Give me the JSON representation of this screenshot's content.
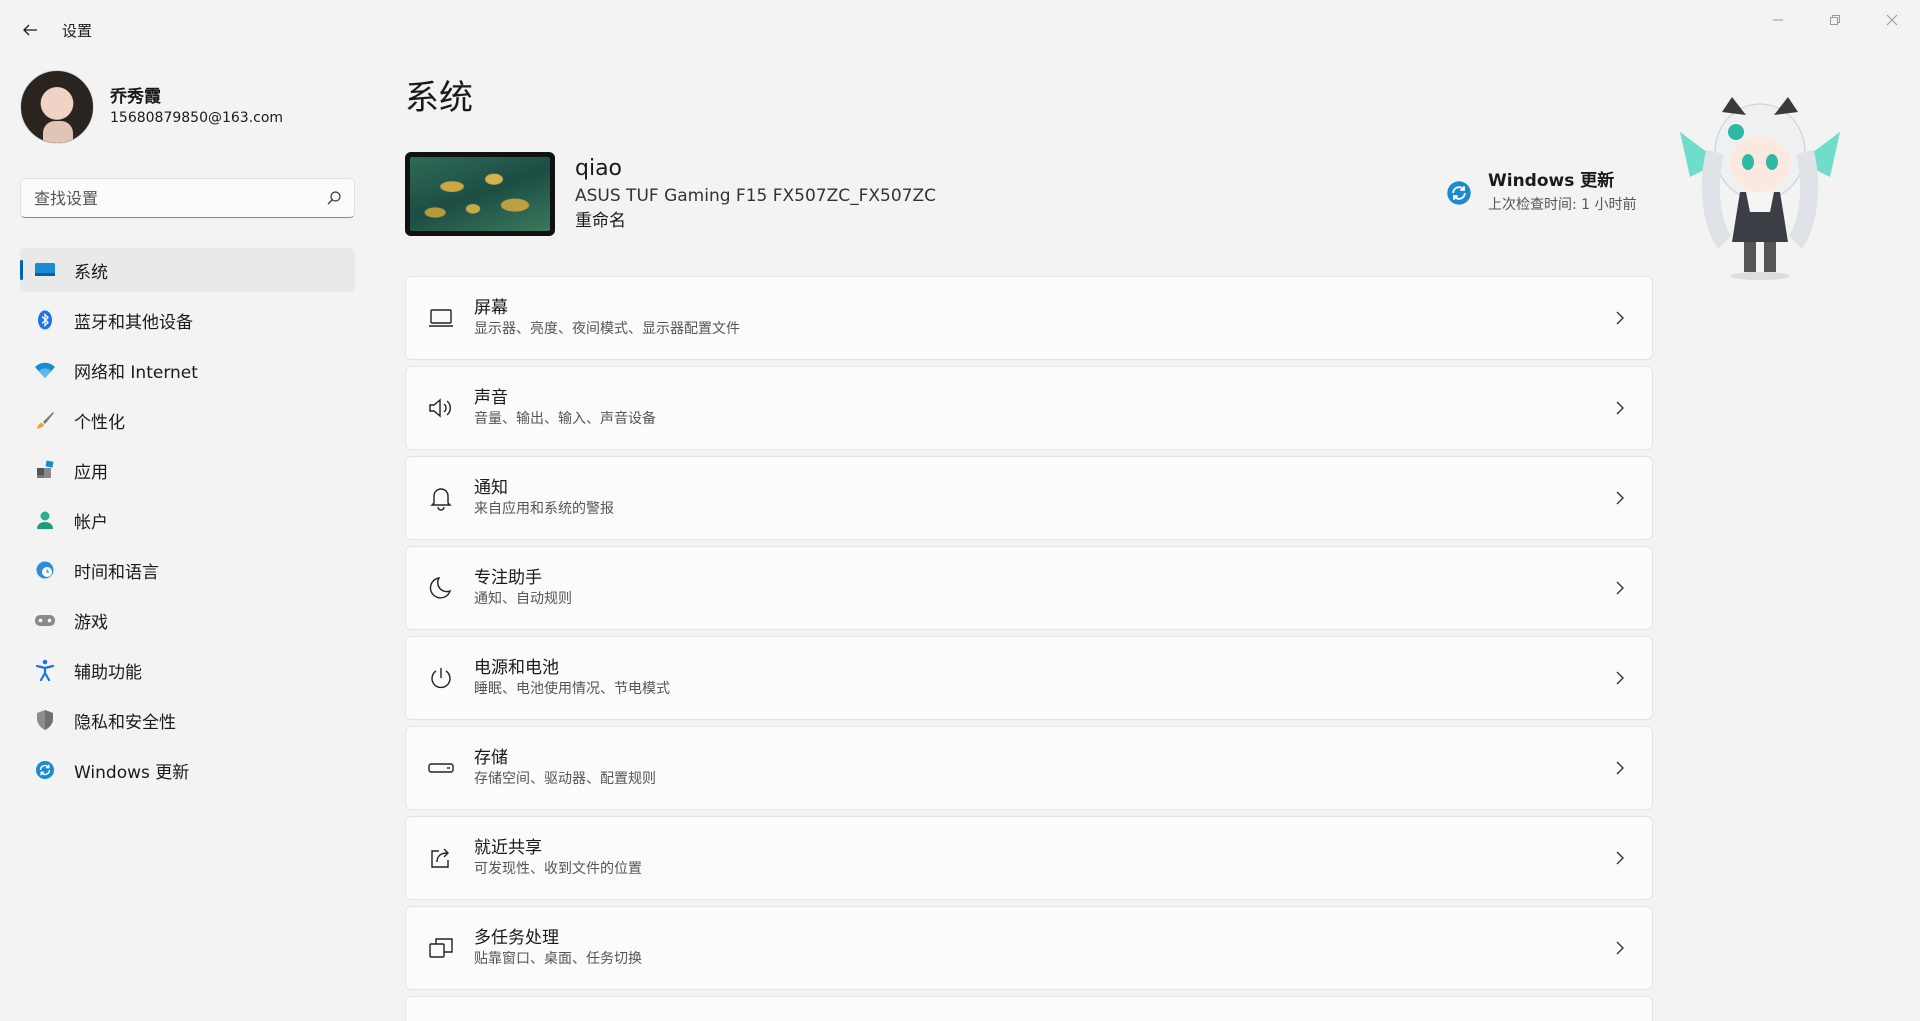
{
  "app": {
    "title": "设置"
  },
  "user": {
    "name": "乔秀霞",
    "email": "15680879850@163.com"
  },
  "search": {
    "placeholder": "查找设置"
  },
  "sidebar": {
    "items": [
      {
        "label": "系统",
        "icon": "system-icon",
        "active": true
      },
      {
        "label": "蓝牙和其他设备",
        "icon": "bluetooth-icon"
      },
      {
        "label": "网络和 Internet",
        "icon": "wifi-icon"
      },
      {
        "label": "个性化",
        "icon": "brush-icon"
      },
      {
        "label": "应用",
        "icon": "apps-icon"
      },
      {
        "label": "帐户",
        "icon": "account-icon"
      },
      {
        "label": "时间和语言",
        "icon": "time-language-icon"
      },
      {
        "label": "游戏",
        "icon": "gamepad-icon"
      },
      {
        "label": "辅助功能",
        "icon": "accessibility-icon"
      },
      {
        "label": "隐私和安全性",
        "icon": "shield-icon"
      },
      {
        "label": "Windows 更新",
        "icon": "windows-update-icon"
      }
    ]
  },
  "main": {
    "title": "系统",
    "device": {
      "name": "qiao",
      "model": "ASUS TUF Gaming F15 FX507ZC_FX507ZC",
      "rename": "重命名"
    },
    "update": {
      "title": "Windows 更新",
      "subtitle": "上次检查时间: 1 小时前"
    },
    "cards": [
      {
        "title": "屏幕",
        "subtitle": "显示器、亮度、夜间模式、显示器配置文件",
        "icon": "display-icon"
      },
      {
        "title": "声音",
        "subtitle": "音量、输出、输入、声音设备",
        "icon": "speaker-icon"
      },
      {
        "title": "通知",
        "subtitle": "来自应用和系统的警报",
        "icon": "bell-icon"
      },
      {
        "title": "专注助手",
        "subtitle": "通知、自动规则",
        "icon": "moon-icon"
      },
      {
        "title": "电源和电池",
        "subtitle": "睡眠、电池使用情况、节电模式",
        "icon": "power-icon"
      },
      {
        "title": "存储",
        "subtitle": "存储空间、驱动器、配置规则",
        "icon": "storage-icon"
      },
      {
        "title": "就近共享",
        "subtitle": "可发现性、收到文件的位置",
        "icon": "share-icon"
      },
      {
        "title": "多任务处理",
        "subtitle": "贴靠窗口、桌面、任务切换",
        "icon": "multitask-icon"
      }
    ]
  },
  "colors": {
    "accent": "#005fb8",
    "background": "#f3f3f3",
    "card": "#fbfbfb"
  }
}
